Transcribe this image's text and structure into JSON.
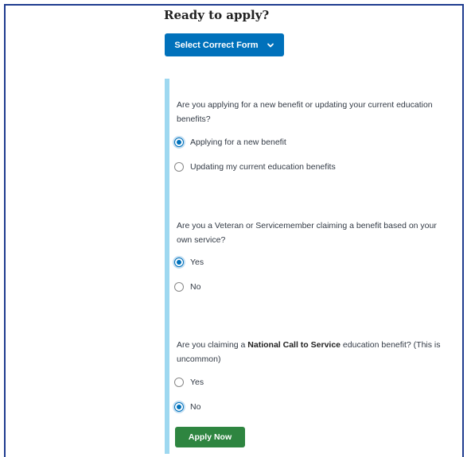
{
  "heading": "Ready to apply?",
  "select_form": {
    "label": "Select Correct Form",
    "icon": "chevron-down-icon",
    "color": "#0071bb"
  },
  "questions": [
    {
      "text": "Are you applying for a new benefit or updating your current education benefits?",
      "options": [
        {
          "label": "Applying for a new benefit",
          "checked": true
        },
        {
          "label": "Updating my current education benefits",
          "checked": false
        }
      ]
    },
    {
      "text": "Are you a Veteran or Servicemember claiming a benefit based on your own service?",
      "options": [
        {
          "label": "Yes",
          "checked": true
        },
        {
          "label": "No",
          "checked": false
        }
      ]
    },
    {
      "text_before": "Are you claiming a ",
      "text_bold": "National Call to Service",
      "text_after": " education benefit? (This is uncommon)",
      "options": [
        {
          "label": "Yes",
          "checked": false
        },
        {
          "label": "No",
          "checked": true
        }
      ]
    }
  ],
  "apply_button": {
    "label": "Apply Now",
    "color": "#2e8540"
  },
  "colors": {
    "frame_border": "#1f3c8f",
    "panel_accent": "#9ed8f0",
    "radio_selected": "#0071bb"
  }
}
